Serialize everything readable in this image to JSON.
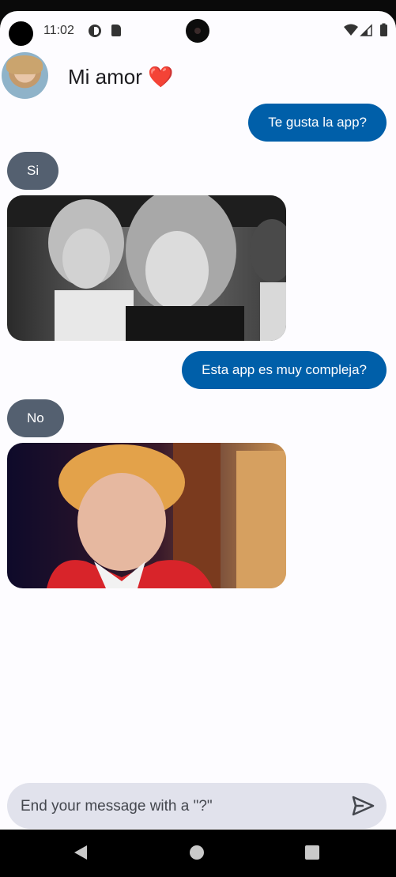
{
  "status_bar": {
    "time": "11:02"
  },
  "contact": {
    "name": "Mi amor ❤️"
  },
  "messages": [
    {
      "from": "me",
      "type": "text",
      "text": "Te gusta la app?"
    },
    {
      "from": "them",
      "type": "text",
      "text": "Si"
    },
    {
      "from": "them",
      "type": "gif",
      "description": ""
    },
    {
      "from": "me",
      "type": "text",
      "text": "Esta app es muy compleja?"
    },
    {
      "from": "them",
      "type": "text",
      "text": "No"
    },
    {
      "from": "them",
      "type": "gif",
      "description": ""
    }
  ],
  "composer": {
    "placeholder": "End your message with a \"?\"",
    "value": ""
  },
  "colors": {
    "my_bubble": "#005fa9",
    "their_bubble": "#546070",
    "background": "#fdfcff",
    "input_bg": "#e1e2ec"
  }
}
